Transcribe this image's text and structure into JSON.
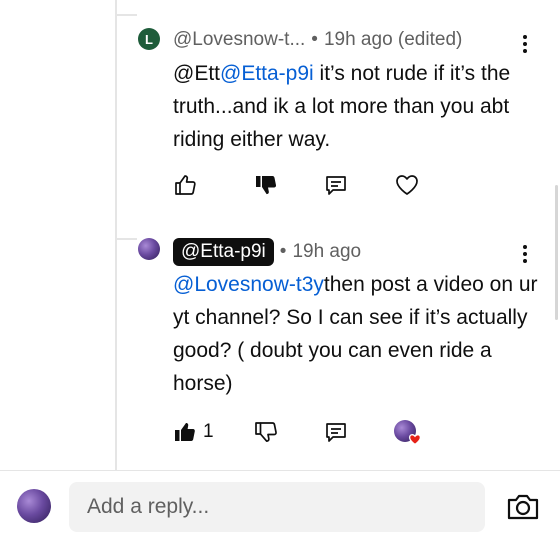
{
  "comments": [
    {
      "avatar_letter": "L",
      "author": "@Lovesnow-t...",
      "time": "19h ago (edited)",
      "text_prefix": "@Ett",
      "mention": "@Etta-p9i",
      "text_rest": " it’s not rude if it’s the truth...and ik a lot more than you abt riding either way.",
      "like_count": ""
    },
    {
      "author": "@Etta-p9i",
      "time": "19h ago",
      "mention": "@Lovesnow-t3y",
      "text_rest": "then post a video on ur yt channel? So I can see if it’s actually good? ( doubt you can even ride a horse)",
      "like_count": "1"
    }
  ],
  "reply_bar": {
    "placeholder": "Add a reply..."
  },
  "icons": {
    "like": "thumbs-up-icon",
    "dislike": "thumbs-down-icon",
    "reply": "comment-icon",
    "heart": "heart-icon",
    "camera": "camera-icon",
    "more": "more-vert-icon"
  },
  "colors": {
    "mention": "#065fd4",
    "heart": "#e62117",
    "handle_chip_bg": "#0f0f0f"
  }
}
